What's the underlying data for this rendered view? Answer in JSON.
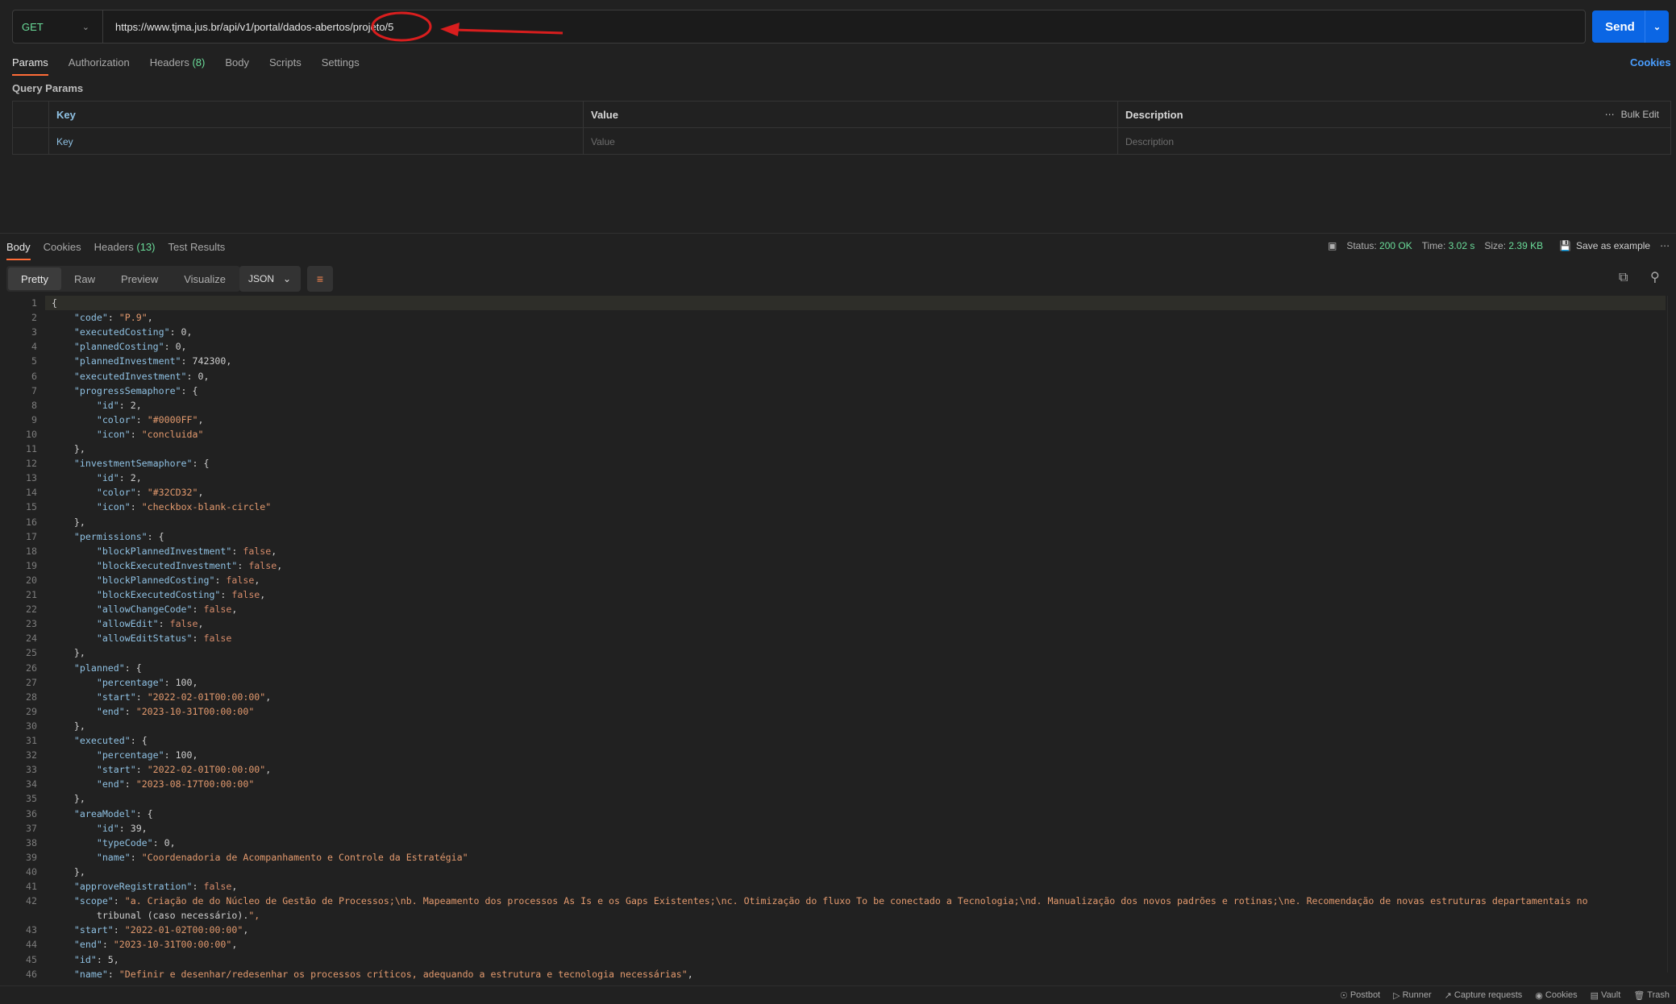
{
  "request": {
    "method": "GET",
    "url": "https://www.tjma.jus.br/api/v1/portal/dados-abertos/projeto/5",
    "send_label": "Send"
  },
  "request_tabs": [
    {
      "label": "Params",
      "count": ""
    },
    {
      "label": "Authorization",
      "count": ""
    },
    {
      "label": "Headers",
      "count": "(8)"
    },
    {
      "label": "Body",
      "count": ""
    },
    {
      "label": "Scripts",
      "count": ""
    },
    {
      "label": "Settings",
      "count": ""
    }
  ],
  "cookies_link": "Cookies",
  "query_params": {
    "title": "Query Params",
    "headers": {
      "key": "Key",
      "value": "Value",
      "description": "Description"
    },
    "bulk_edit": "Bulk Edit",
    "placeholders": {
      "key": "Key",
      "value": "Value",
      "description": "Description"
    }
  },
  "response_tabs": [
    {
      "label": "Body",
      "count": ""
    },
    {
      "label": "Cookies",
      "count": ""
    },
    {
      "label": "Headers",
      "count": "(13)"
    },
    {
      "label": "Test Results",
      "count": ""
    }
  ],
  "response_meta": {
    "status_label": "Status:",
    "status_value": "200 OK",
    "time_label": "Time:",
    "time_value": "3.02 s",
    "size_label": "Size:",
    "size_value": "2.39 KB",
    "save_label": "Save as example"
  },
  "view_modes": [
    "Pretty",
    "Raw",
    "Preview",
    "Visualize"
  ],
  "format": "JSON",
  "code_lines": [
    "{",
    "    \"code\": \"P.9\",",
    "    \"executedCosting\": 0,",
    "    \"plannedCosting\": 0,",
    "    \"plannedInvestment\": 742300,",
    "    \"executedInvestment\": 0,",
    "    \"progressSemaphore\": {",
    "        \"id\": 2,",
    "        \"color\": \"#0000FF\",",
    "        \"icon\": \"concluida\"",
    "    },",
    "    \"investmentSemaphore\": {",
    "        \"id\": 2,",
    "        \"color\": \"#32CD32\",",
    "        \"icon\": \"checkbox-blank-circle\"",
    "    },",
    "    \"permissions\": {",
    "        \"blockPlannedInvestment\": false,",
    "        \"blockExecutedInvestment\": false,",
    "        \"blockPlannedCosting\": false,",
    "        \"blockExecutedCosting\": false,",
    "        \"allowChangeCode\": false,",
    "        \"allowEdit\": false,",
    "        \"allowEditStatus\": false",
    "    },",
    "    \"planned\": {",
    "        \"percentage\": 100,",
    "        \"start\": \"2022-02-01T00:00:00\",",
    "        \"end\": \"2023-10-31T00:00:00\"",
    "    },",
    "    \"executed\": {",
    "        \"percentage\": 100,",
    "        \"start\": \"2022-02-01T00:00:00\",",
    "        \"end\": \"2023-08-17T00:00:00\"",
    "    },",
    "    \"areaModel\": {",
    "        \"id\": 39,",
    "        \"typeCode\": 0,",
    "        \"name\": \"Coordenadoria de Acompanhamento e Controle da Estratégia\"",
    "    },",
    "    \"approveRegistration\": false,",
    "    \"scope\": \"a. Criação de do Núcleo de Gestão de Processos;\\nb. Mapeamento dos processos As Is e os Gaps Existentes;\\nc. Otimização do fluxo To be conectado a Tecnologia;\\nd. Manualização dos novos padrões e rotinas;\\ne. Recomendação de novas estruturas departamentais no",
    "        tribunal (caso necessário).\",",
    "    \"start\": \"2022-01-02T00:00:00\",",
    "    \"end\": \"2023-10-31T00:00:00\",",
    "    \"id\": 5,",
    "    \"name\": \"Definir e desenhar/redesenhar os processos críticos, adequando a estrutura e tecnologia necessárias\","
  ],
  "line_numbers": [
    "1",
    "2",
    "3",
    "4",
    "5",
    "6",
    "7",
    "8",
    "9",
    "10",
    "11",
    "12",
    "13",
    "14",
    "15",
    "16",
    "17",
    "18",
    "19",
    "20",
    "21",
    "22",
    "23",
    "24",
    "25",
    "26",
    "27",
    "28",
    "29",
    "30",
    "31",
    "32",
    "33",
    "34",
    "35",
    "36",
    "37",
    "38",
    "39",
    "40",
    "41",
    "42",
    "",
    "43",
    "44",
    "45",
    "46"
  ],
  "footer": [
    "Postbot",
    "Runner",
    "Capture requests",
    "Cookies",
    "Vault",
    "Trash"
  ]
}
